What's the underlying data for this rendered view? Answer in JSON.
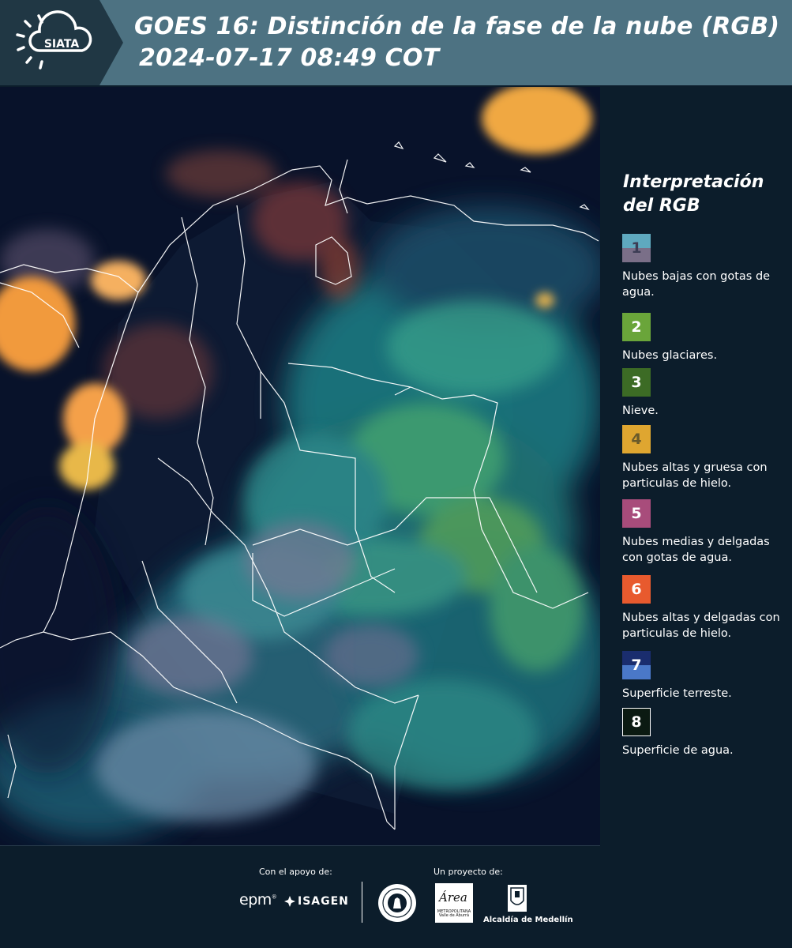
{
  "header": {
    "logo_text": "SIATA",
    "title_line1": "GOES 16: Distinción de la fase de la nube (RGB)",
    "title_line2": "2024-07-17 08:49 COT"
  },
  "colors": {
    "header_bg": "#4d7282",
    "page_bg": "#0c1d2b",
    "map_ocean": "#08122a"
  },
  "legend": {
    "title": "Interpretación del RGB",
    "items": [
      {
        "number": "1",
        "label": "Nubes bajas con gotas de agua.",
        "color_top": "#5fa9bf",
        "color_bottom": "#7a6f88",
        "text_color": "#3d3d55"
      },
      {
        "number": "2",
        "label": "Nubes glaciares.",
        "color_top": "#6aa53a",
        "color_bottom": "#6aa53a",
        "text_color": "#ffffff"
      },
      {
        "number": "3",
        "label": "Nieve.",
        "color_top": "#3c6b25",
        "color_bottom": "#3c6b25",
        "text_color": "#ffffff"
      },
      {
        "number": "4",
        "label": "Nubes altas y gruesa con particulas de hielo.",
        "color_top": "#dfa630",
        "color_bottom": "#dfa630",
        "text_color": "#6a5a2a"
      },
      {
        "number": "5",
        "label": "Nubes medias y delgadas con gotas de agua.",
        "color_top": "#a84c7b",
        "color_bottom": "#a84c7b",
        "text_color": "#ffffff"
      },
      {
        "number": "6",
        "label": "Nubes altas y delgadas con particulas de hielo.",
        "color_top": "#e85a2e",
        "color_bottom": "#e85a2e",
        "text_color": "#ffffff"
      },
      {
        "number": "7",
        "label": "Superficie terreste.",
        "color_top": "#1a2d6e",
        "color_bottom": "#4a78c8",
        "text_color": "#ffffff"
      },
      {
        "number": "8",
        "label": "Superficie de agua.",
        "color_top": "#0b1a12",
        "color_bottom": "#0b1a12",
        "text_color": "#ffffff"
      }
    ]
  },
  "footer": {
    "support_label": "Con el apoyo de:",
    "project_label": "Un proyecto de:",
    "epm": "epm",
    "isagen": "ISAGEN",
    "area_word": "Área",
    "area_subtitle": "METROPOLITANA Valle de Aburrá",
    "alcaldia": "Alcaldía de Medellín"
  }
}
